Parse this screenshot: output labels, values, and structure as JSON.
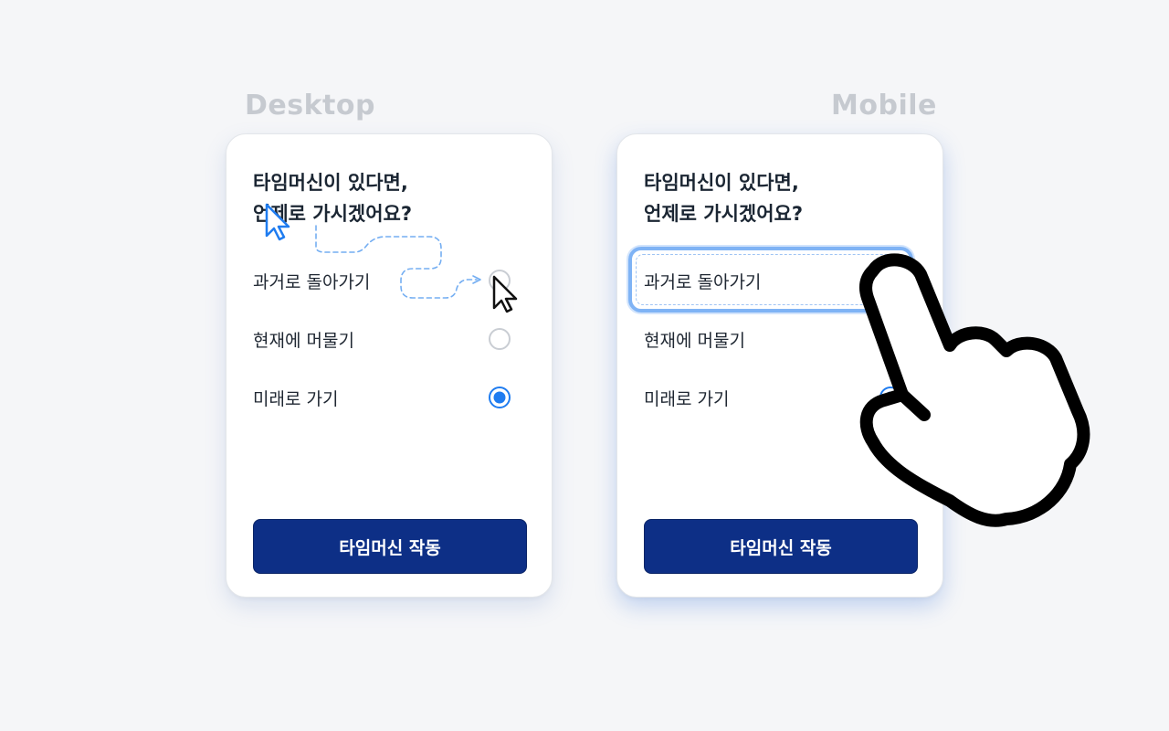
{
  "labels": {
    "desktop": "Desktop",
    "mobile": "Mobile"
  },
  "desktop": {
    "question_line1": "타임머신이 있다면,",
    "question_line2": "언제로 가시겠어요?",
    "options": [
      {
        "label": "과거로 돌아가기",
        "selected": false
      },
      {
        "label": "현재에 머물기",
        "selected": false
      },
      {
        "label": "미래로 가기",
        "selected": true
      }
    ],
    "button_label": "타임머신 작동"
  },
  "mobile": {
    "question_line1": "타임머신이 있다면,",
    "question_line2": "언제로 가시겠어요?",
    "options": [
      {
        "label": "과거로 돌아가기",
        "selected": false,
        "focused": true
      },
      {
        "label": "현재에 머물기",
        "selected": false
      },
      {
        "label": "미래로 가기",
        "selected": true
      }
    ],
    "button_label": "타임머신 작동"
  },
  "icons": {
    "desktop_cursor_start": "arrow-cursor-icon",
    "desktop_cursor_end": "arrow-cursor-icon",
    "mobile_pointer": "tap-hand-icon"
  },
  "colors": {
    "background": "#f5f6f8",
    "primary": "#0d2f86",
    "accent": "#1f7cf0",
    "focus_ring": "#7fb3f5",
    "label_gray": "#c6cad0"
  }
}
